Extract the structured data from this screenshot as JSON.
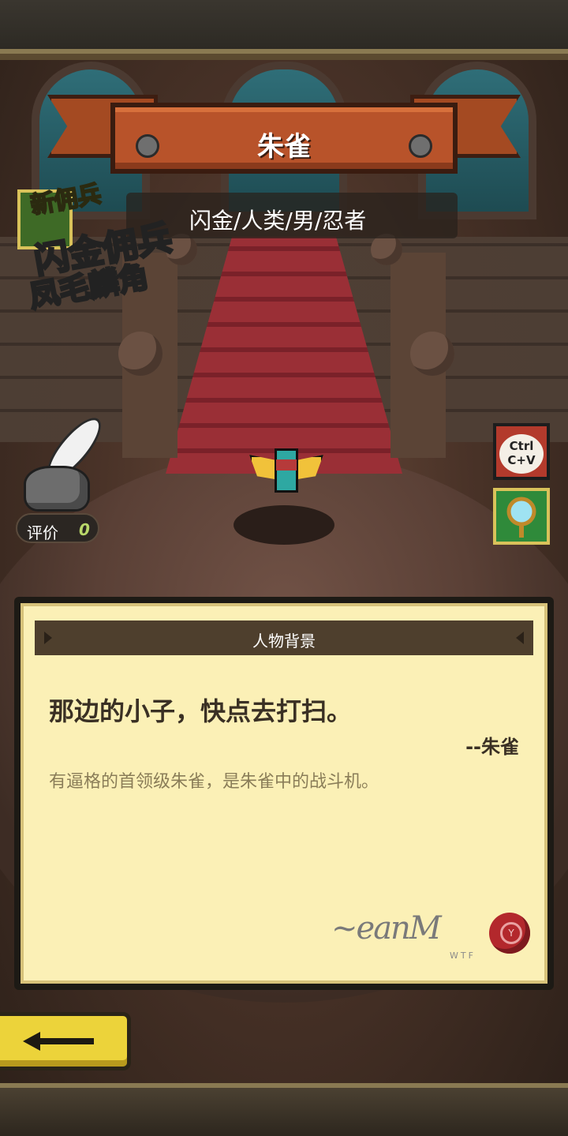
{
  "hero": {
    "name": "朱雀",
    "meta": "闪金/人类/男/忍者"
  },
  "promo": {
    "tag": "新佣兵",
    "line1": "闪金佣兵",
    "line2": "凤毛麟角"
  },
  "rating": {
    "label": "评价",
    "value": "0"
  },
  "side_buttons": {
    "copy": "Ctrl C+V",
    "mirror_icon": "mirror-icon"
  },
  "panel": {
    "title": "人物背景",
    "quote": "那边的小子，快点去打扫。",
    "attribution": "--朱雀",
    "description": "有逼格的首领级朱雀，是朱雀中的战斗机。",
    "signature_text": "WTF",
    "seal_letter": "Y"
  },
  "nav": {
    "back_icon": "back-arrow-icon"
  },
  "colors": {
    "banner": "#b8532a",
    "parchment": "#fbf0b6",
    "back_button": "#ecd33a",
    "rating_value": "#b9d86a"
  }
}
